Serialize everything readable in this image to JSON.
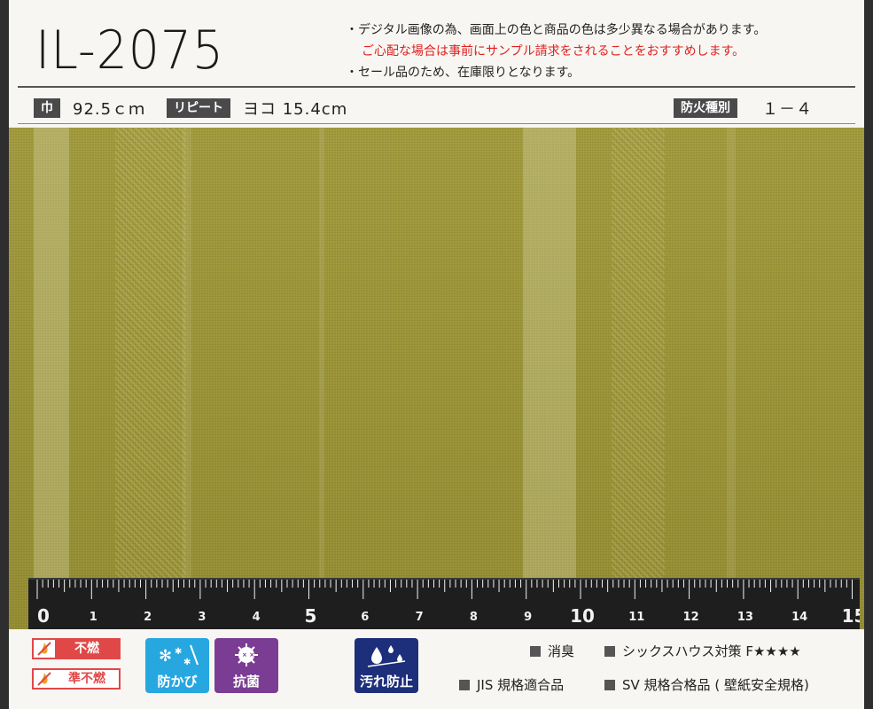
{
  "product": {
    "code": "IL-2075"
  },
  "notes": {
    "line1": "・デジタル画像の為、画面上の色と商品の色は多少異なる場合があります。",
    "line2": "ご心配な場合は事前にサンプル請求をされることをおすすめします。",
    "line3": "・セール品のため、在庫限りとなります。"
  },
  "specs": {
    "width_label": "巾",
    "width_value": "92.5ｃｍ",
    "repeat_label": "リピート",
    "repeat_value": "ヨコ 15.4cm",
    "fire_label": "防火種別",
    "fire_value": "１－４"
  },
  "swatch": {
    "color": "#9a9336",
    "description_icon": "fabric-swatch"
  },
  "ruler": {
    "numbers": [
      "0",
      "1",
      "2",
      "3",
      "4",
      "5",
      "6",
      "7",
      "8",
      "9",
      "10",
      "11",
      "12",
      "13",
      "14",
      "15"
    ],
    "unit": "cm"
  },
  "badges": {
    "fire1": "不燃",
    "fire2": "準不燃",
    "mold": "防かび",
    "antibacterial": "抗菌",
    "stain": "汚れ防止"
  },
  "features": {
    "deodorize": "消臭",
    "sickhouse": "シックスハウス対策 F★★★★",
    "jis": "JIS 規格適合品",
    "sv": "SV 規格合格品 ( 壁紙安全規格)"
  },
  "colors": {
    "fire_red": "#e04848",
    "mold_blue": "#27a7e0",
    "antibacterial_purple": "#7b3c93",
    "stain_navy": "#1d2f7a",
    "ruler_black": "#1e1e1e"
  }
}
